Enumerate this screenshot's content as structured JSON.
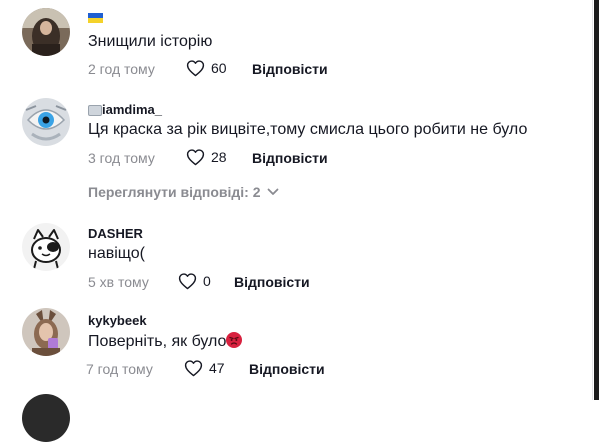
{
  "comments": [
    {
      "username": "",
      "flag": "ukraine-flag",
      "text": "Знищили історію",
      "time": "2 год тому",
      "likes": "60",
      "reply": "Відповісти"
    },
    {
      "username": "iamdima_",
      "username_prefix_icon": "image-icon",
      "text": "Ця краска за рік вицвіте,тому смисла цього робити не було",
      "time": "3 год тому",
      "likes": "28",
      "reply": "Відповісти",
      "view_replies": "Переглянути відповіді: 2"
    },
    {
      "username": "DASHER",
      "text": "навіщо(",
      "time": "5 хв тому",
      "likes": "0",
      "reply": "Відповісти"
    },
    {
      "username": "kykybeek",
      "text": "Поверніть, як було",
      "text_emoji": "angry-face-emoji",
      "time": "7 год тому",
      "likes": "47",
      "reply": "Відповісти"
    }
  ],
  "colors": {
    "text": "#161823",
    "muted": "#8a8b91",
    "flag_blue": "#1f5fd1",
    "flag_yellow": "#f4d22a"
  }
}
